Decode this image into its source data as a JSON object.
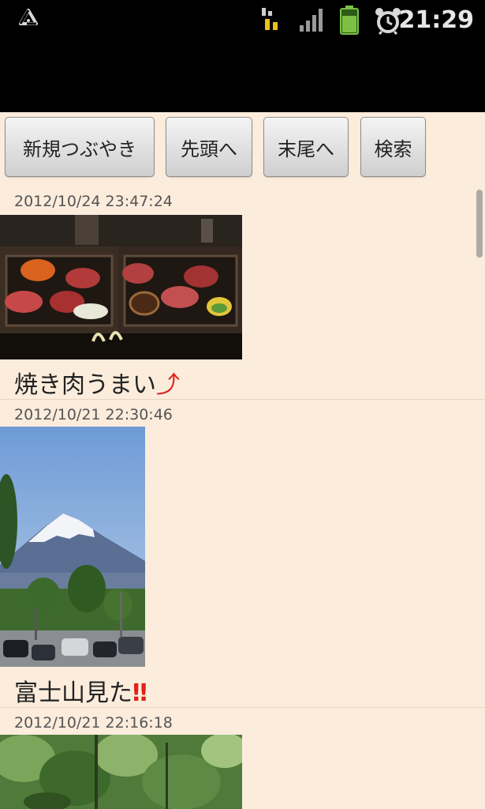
{
  "status_bar": {
    "icons": [
      "recycle-icon",
      "data-signal-icon",
      "signal-icon",
      "battery-icon",
      "alarm-icon"
    ],
    "time": "21:29"
  },
  "toolbar": {
    "new_post_label": "新規つぶやき",
    "top_label": "先頭へ",
    "end_label": "末尾へ",
    "search_label": "検索"
  },
  "posts": [
    {
      "timestamp": "2012/10/24 23:47:24",
      "text": "焼き肉うまい",
      "emoji": "⤴",
      "photo": "grilled-meat-photo"
    },
    {
      "timestamp": "2012/10/21 22:30:46",
      "text": "富士山見た",
      "emoji": "‼",
      "photo": "mount-fuji-photo"
    },
    {
      "timestamp": "2012/10/21 22:16:18",
      "photo": "green-trees-photo"
    }
  ],
  "colors": {
    "background": "#fbecdc",
    "status_bar": "#000000",
    "emoji_red": "#e0201a"
  }
}
